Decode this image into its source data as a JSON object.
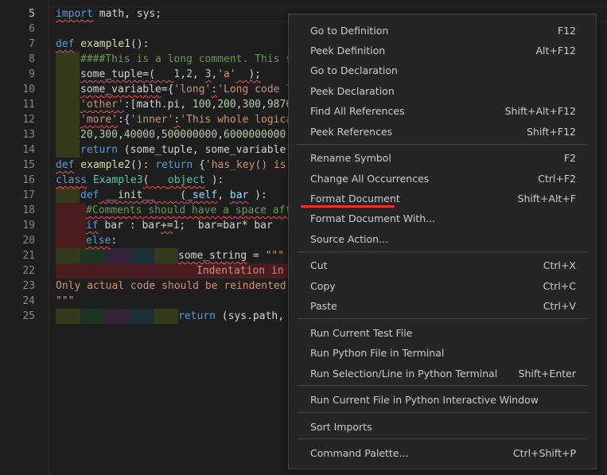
{
  "editor": {
    "lines": [
      {
        "n": "5",
        "cur": true
      },
      {
        "n": "6"
      },
      {
        "n": "7"
      },
      {
        "n": "8"
      },
      {
        "n": "9"
      },
      {
        "n": "10"
      },
      {
        "n": "11"
      },
      {
        "n": "12"
      },
      {
        "n": "13"
      },
      {
        "n": "14"
      },
      {
        "n": "15"
      },
      {
        "n": "16"
      },
      {
        "n": "17"
      },
      {
        "n": "18"
      },
      {
        "n": "19"
      },
      {
        "n": "20"
      },
      {
        "n": "21"
      },
      {
        "n": "22"
      },
      {
        "n": "23"
      },
      {
        "n": "24"
      },
      {
        "n": "25"
      }
    ],
    "code": {
      "l5a": "import",
      "l5b": " math, sys;",
      "l7a": "def",
      "l7b": " example1",
      "l7c": "():",
      "l8": "####This is a long comment. This s",
      "l9a": "some_tuple",
      "l9b": "=(   ",
      "l9c": "1",
      "l9d": ",",
      "l9e": "2",
      "l9f": ", ",
      "l9g": "3",
      "l9h": ",",
      "l9i": "'a'",
      "l9j": "  );",
      "l10a": "some_variable",
      "l10b": "={",
      "l10c": "'long'",
      "l10d": ":",
      "l10e": "'Long code l",
      "l11a": "'other'",
      "l11b": ":[math.pi, ",
      "l11c": "100",
      "l11d": ",",
      "l11e": "200",
      "l11f": ",",
      "l11g": "300",
      "l11h": ",",
      "l11i": "9876",
      "l12a": "'more'",
      "l12b": ":{",
      "l12c": "'inner'",
      "l12d": ":",
      "l12e": "'This whole logica",
      "l13a": "20",
      "l13b": ",",
      "l13c": "300",
      "l13d": ",",
      "l13e": "40000",
      "l13f": ",",
      "l13g": "500000000",
      "l13h": ",",
      "l13i": "6000000000",
      "l14a": "return",
      "l14b": " (some_tuple, some_variable)",
      "l15a": "def",
      "l15b": " example2",
      "l15c": "(): ",
      "l15d": "return",
      "l15e": " {",
      "l15f": "'has_key() is",
      "l16a": "class",
      "l16b": " Example3",
      "l16c": "(   ",
      "l16d": "object",
      "l16e": " ):",
      "l17a": "def",
      "l17b": " __init__",
      "l17c": "    (",
      "l17d": "_self",
      "l17e": ", ",
      "l17f": "bar",
      "l17g": " ):",
      "l18": "#Comments should have a space aft",
      "l19a": "if",
      "l19b": " bar : bar",
      "l19c": "+=",
      "l19d": "1",
      "l19e": ";  bar=bar* bar",
      "l20a": "else",
      "l20b": ":",
      "l21a": "some_string",
      "l21b": " = ",
      "l21c": "\"\"\"",
      "l22": "Indentation in",
      "l23": "Only actual code should be reindented.",
      "l24": "\"\"\"",
      "l25a": "return",
      "l25b": " (sys.path,"
    }
  },
  "context_menu": {
    "items": [
      {
        "label": "Go to Definition",
        "key": "F12"
      },
      {
        "label": "Peek Definition",
        "key": "Alt+F12"
      },
      {
        "label": "Go to Declaration",
        "key": ""
      },
      {
        "label": "Peek Declaration",
        "key": ""
      },
      {
        "label": "Find All References",
        "key": "Shift+Alt+F12"
      },
      {
        "label": "Peek References",
        "key": "Shift+F12"
      },
      {
        "label": "Rename Symbol",
        "key": "F2"
      },
      {
        "label": "Change All Occurrences",
        "key": "Ctrl+F2"
      },
      {
        "label": "Format Document",
        "key": "Shift+Alt+F"
      },
      {
        "label": "Format Document With...",
        "key": ""
      },
      {
        "label": "Source Action...",
        "key": ""
      },
      {
        "label": "Cut",
        "key": "Ctrl+X"
      },
      {
        "label": "Copy",
        "key": "Ctrl+C"
      },
      {
        "label": "Paste",
        "key": "Ctrl+V"
      },
      {
        "label": "Run Current Test File",
        "key": ""
      },
      {
        "label": "Run Python File in Terminal",
        "key": ""
      },
      {
        "label": "Run Selection/Line in Python Terminal",
        "key": "Shift+Enter"
      },
      {
        "label": "Run Current File in Python Interactive Window",
        "key": ""
      },
      {
        "label": "Sort Imports",
        "key": ""
      },
      {
        "label": "Command Palette...",
        "key": "Ctrl+Shift+P"
      }
    ]
  },
  "colors": {
    "annotation_underline": "#e8322b",
    "indent_yellow": "#3a3d1f",
    "indent_green": "#1f3a2a",
    "indent_purple": "#3a2438",
    "indent_teal": "#1f3138",
    "indent_error": "#5a1f22"
  }
}
